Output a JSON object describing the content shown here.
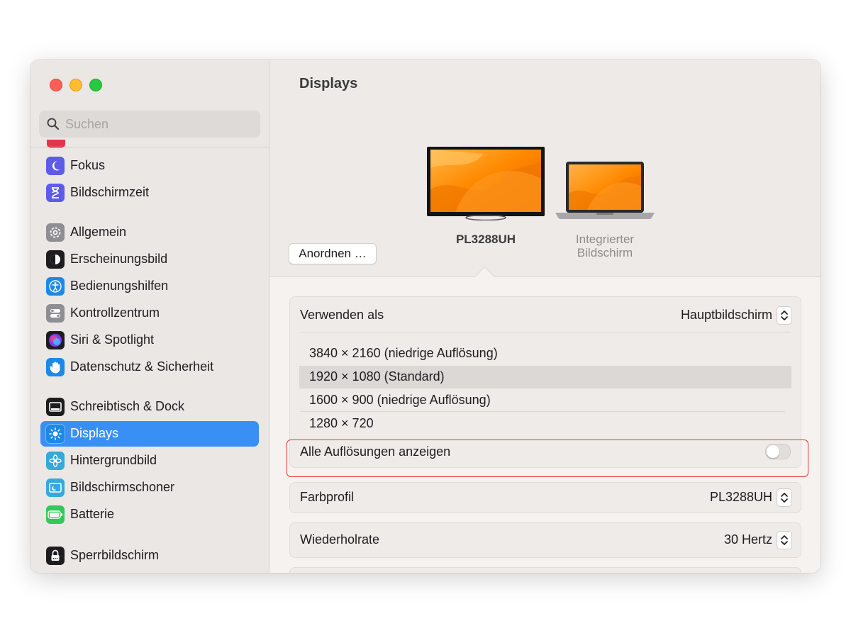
{
  "sidebar": {
    "search_placeholder": "Suchen",
    "items": [
      {
        "label": "Fokus",
        "icon": "moon-icon",
        "color": "#5e5ce6"
      },
      {
        "label": "Bildschirmzeit",
        "icon": "hourglass-icon",
        "color": "#5e5ce6"
      },
      {
        "label": "Allgemein",
        "icon": "gear-icon",
        "color": "#8e8e93"
      },
      {
        "label": "Erscheinungsbild",
        "icon": "appearance-icon",
        "color": "#1d1d1f"
      },
      {
        "label": "Bedienungshilfen",
        "icon": "accessibility-icon",
        "color": "#1e88e5"
      },
      {
        "label": "Kontrollzentrum",
        "icon": "switches-icon",
        "color": "#8e8e93"
      },
      {
        "label": "Siri & Spotlight",
        "icon": "siri-icon",
        "color": "#7a3cff"
      },
      {
        "label": "Datenschutz & Sicherheit",
        "icon": "hand-icon",
        "color": "#1e88e5"
      },
      {
        "label": "Schreibtisch & Dock",
        "icon": "dock-icon",
        "color": "#1d1d1f"
      },
      {
        "label": "Displays",
        "icon": "sun-icon",
        "color": "#1e88e5",
        "selected": true
      },
      {
        "label": "Hintergrundbild",
        "icon": "flower-icon",
        "color": "#34aadc"
      },
      {
        "label": "Bildschirmschoner",
        "icon": "screensaver-icon",
        "color": "#34aadc"
      },
      {
        "label": "Batterie",
        "icon": "battery-icon",
        "color": "#34c759"
      },
      {
        "label": "Sperrbildschirm",
        "icon": "lock-icon",
        "color": "#1d1d1f"
      }
    ]
  },
  "main": {
    "title": "Displays",
    "arrange_label": "Anordnen …",
    "displays": [
      {
        "name": "PL3288UH",
        "selected": true
      },
      {
        "name_line1": "Integrierter",
        "name_line2": "Bildschirm"
      }
    ],
    "use_as": {
      "label": "Verwenden als",
      "value": "Hauptbildschirm"
    },
    "resolutions": [
      {
        "label": "3840 × 2160 (niedrige Auflösung)"
      },
      {
        "label": "1920 × 1080 (Standard)",
        "selected": true
      },
      {
        "label": "1600 × 900 (niedrige Auflösung)"
      },
      {
        "label": "1280 × 720"
      }
    ],
    "show_all": {
      "label": "Alle Auflösungen anzeigen",
      "on": false
    },
    "color_profile": {
      "label": "Farbprofil",
      "value": "PL3288UH"
    },
    "refresh_rate": {
      "label": "Wiederholrate",
      "value": "30 Hertz"
    }
  },
  "colors": {
    "accent": "#3a8ff5",
    "highlight": "#e53935"
  }
}
